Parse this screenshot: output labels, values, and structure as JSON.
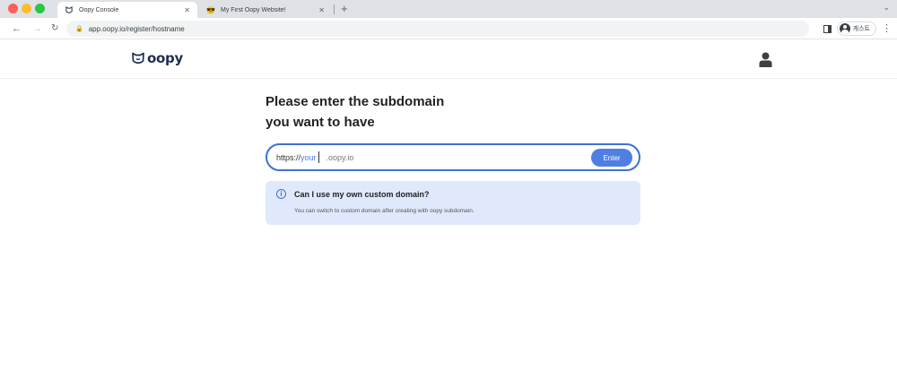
{
  "browser": {
    "tabs": [
      {
        "title": "Oopy Console",
        "favicon": "oopy-logo-icon",
        "active": true
      },
      {
        "title": "My First Oopy Website!",
        "favicon": "emoji-icon",
        "active": false
      }
    ],
    "new_tab_label": "+",
    "url": "app.oopy.io/register/hostname",
    "profile_label": "게스트"
  },
  "site": {
    "logo_text": "oopy",
    "user_icon": "user-icon"
  },
  "main": {
    "heading_line1": "Please enter the subdomain",
    "heading_line2": "you want to have",
    "input": {
      "prefix": "https://",
      "value": "your",
      "suffix": ".oopy.io"
    },
    "enter_label": "Enter",
    "info": {
      "title": "Can I use my own custom domain?",
      "body": "You can switch to custom domain after creating with oopy subdomain."
    }
  },
  "colors": {
    "accent": "#4f7fe3",
    "info_bg": "#dfe9fb",
    "logo": "#1f2e4d"
  }
}
